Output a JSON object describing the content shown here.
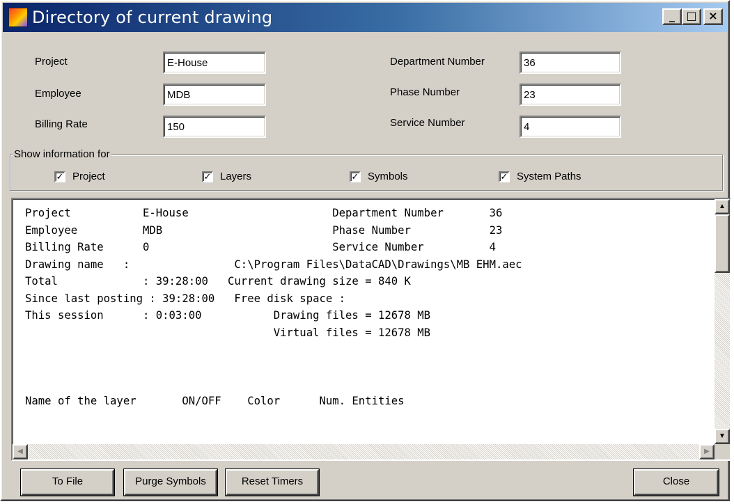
{
  "window": {
    "title": "Directory of current drawing",
    "controls": {
      "minimize": "_",
      "maximize": "□",
      "close": "×"
    }
  },
  "fields": {
    "project": {
      "label": "Project",
      "value": "E-House"
    },
    "employee": {
      "label": "Employee",
      "value": "MDB"
    },
    "billing_rate": {
      "label": "Billing Rate",
      "value": "150"
    },
    "department_number": {
      "label": "Department Number",
      "value": "36"
    },
    "phase_number": {
      "label": "Phase Number",
      "value": "23"
    },
    "service_number": {
      "label": "Service Number",
      "value": "4"
    }
  },
  "show_info": {
    "legend": "Show information for",
    "options": [
      {
        "label": "Project",
        "checked": true
      },
      {
        "label": "Layers",
        "checked": true
      },
      {
        "label": "Symbols",
        "checked": true
      },
      {
        "label": "System Paths",
        "checked": true
      }
    ]
  },
  "report_lines": [
    "Project           E-House                      Department Number       36",
    "Employee          MDB                          Phase Number            23",
    "Billing Rate      0                            Service Number          4",
    "Drawing name   :                C:\\Program Files\\DataCAD\\Drawings\\MB EHM.aec",
    "Total             : 39:28:00   Current drawing size = 840 K",
    "Since last posting : 39:28:00   Free disk space :",
    "This session      : 0:03:00           Drawing files = 12678 MB",
    "                                      Virtual files = 12678 MB",
    "",
    "",
    "",
    "Name of the layer       ON/OFF    Color      Num. Entities"
  ],
  "scroll_glyphs": {
    "up": "▲",
    "down": "▼",
    "left": "◀",
    "right": "▶"
  },
  "buttons": {
    "to_file": "To File",
    "purge_symbols": "Purge Symbols",
    "reset_timers": "Reset Timers",
    "close": "Close"
  },
  "colors": {
    "title_gradient_start": "#0a246a",
    "title_gradient_end": "#a6caf0",
    "face": "#d4d0c8"
  }
}
